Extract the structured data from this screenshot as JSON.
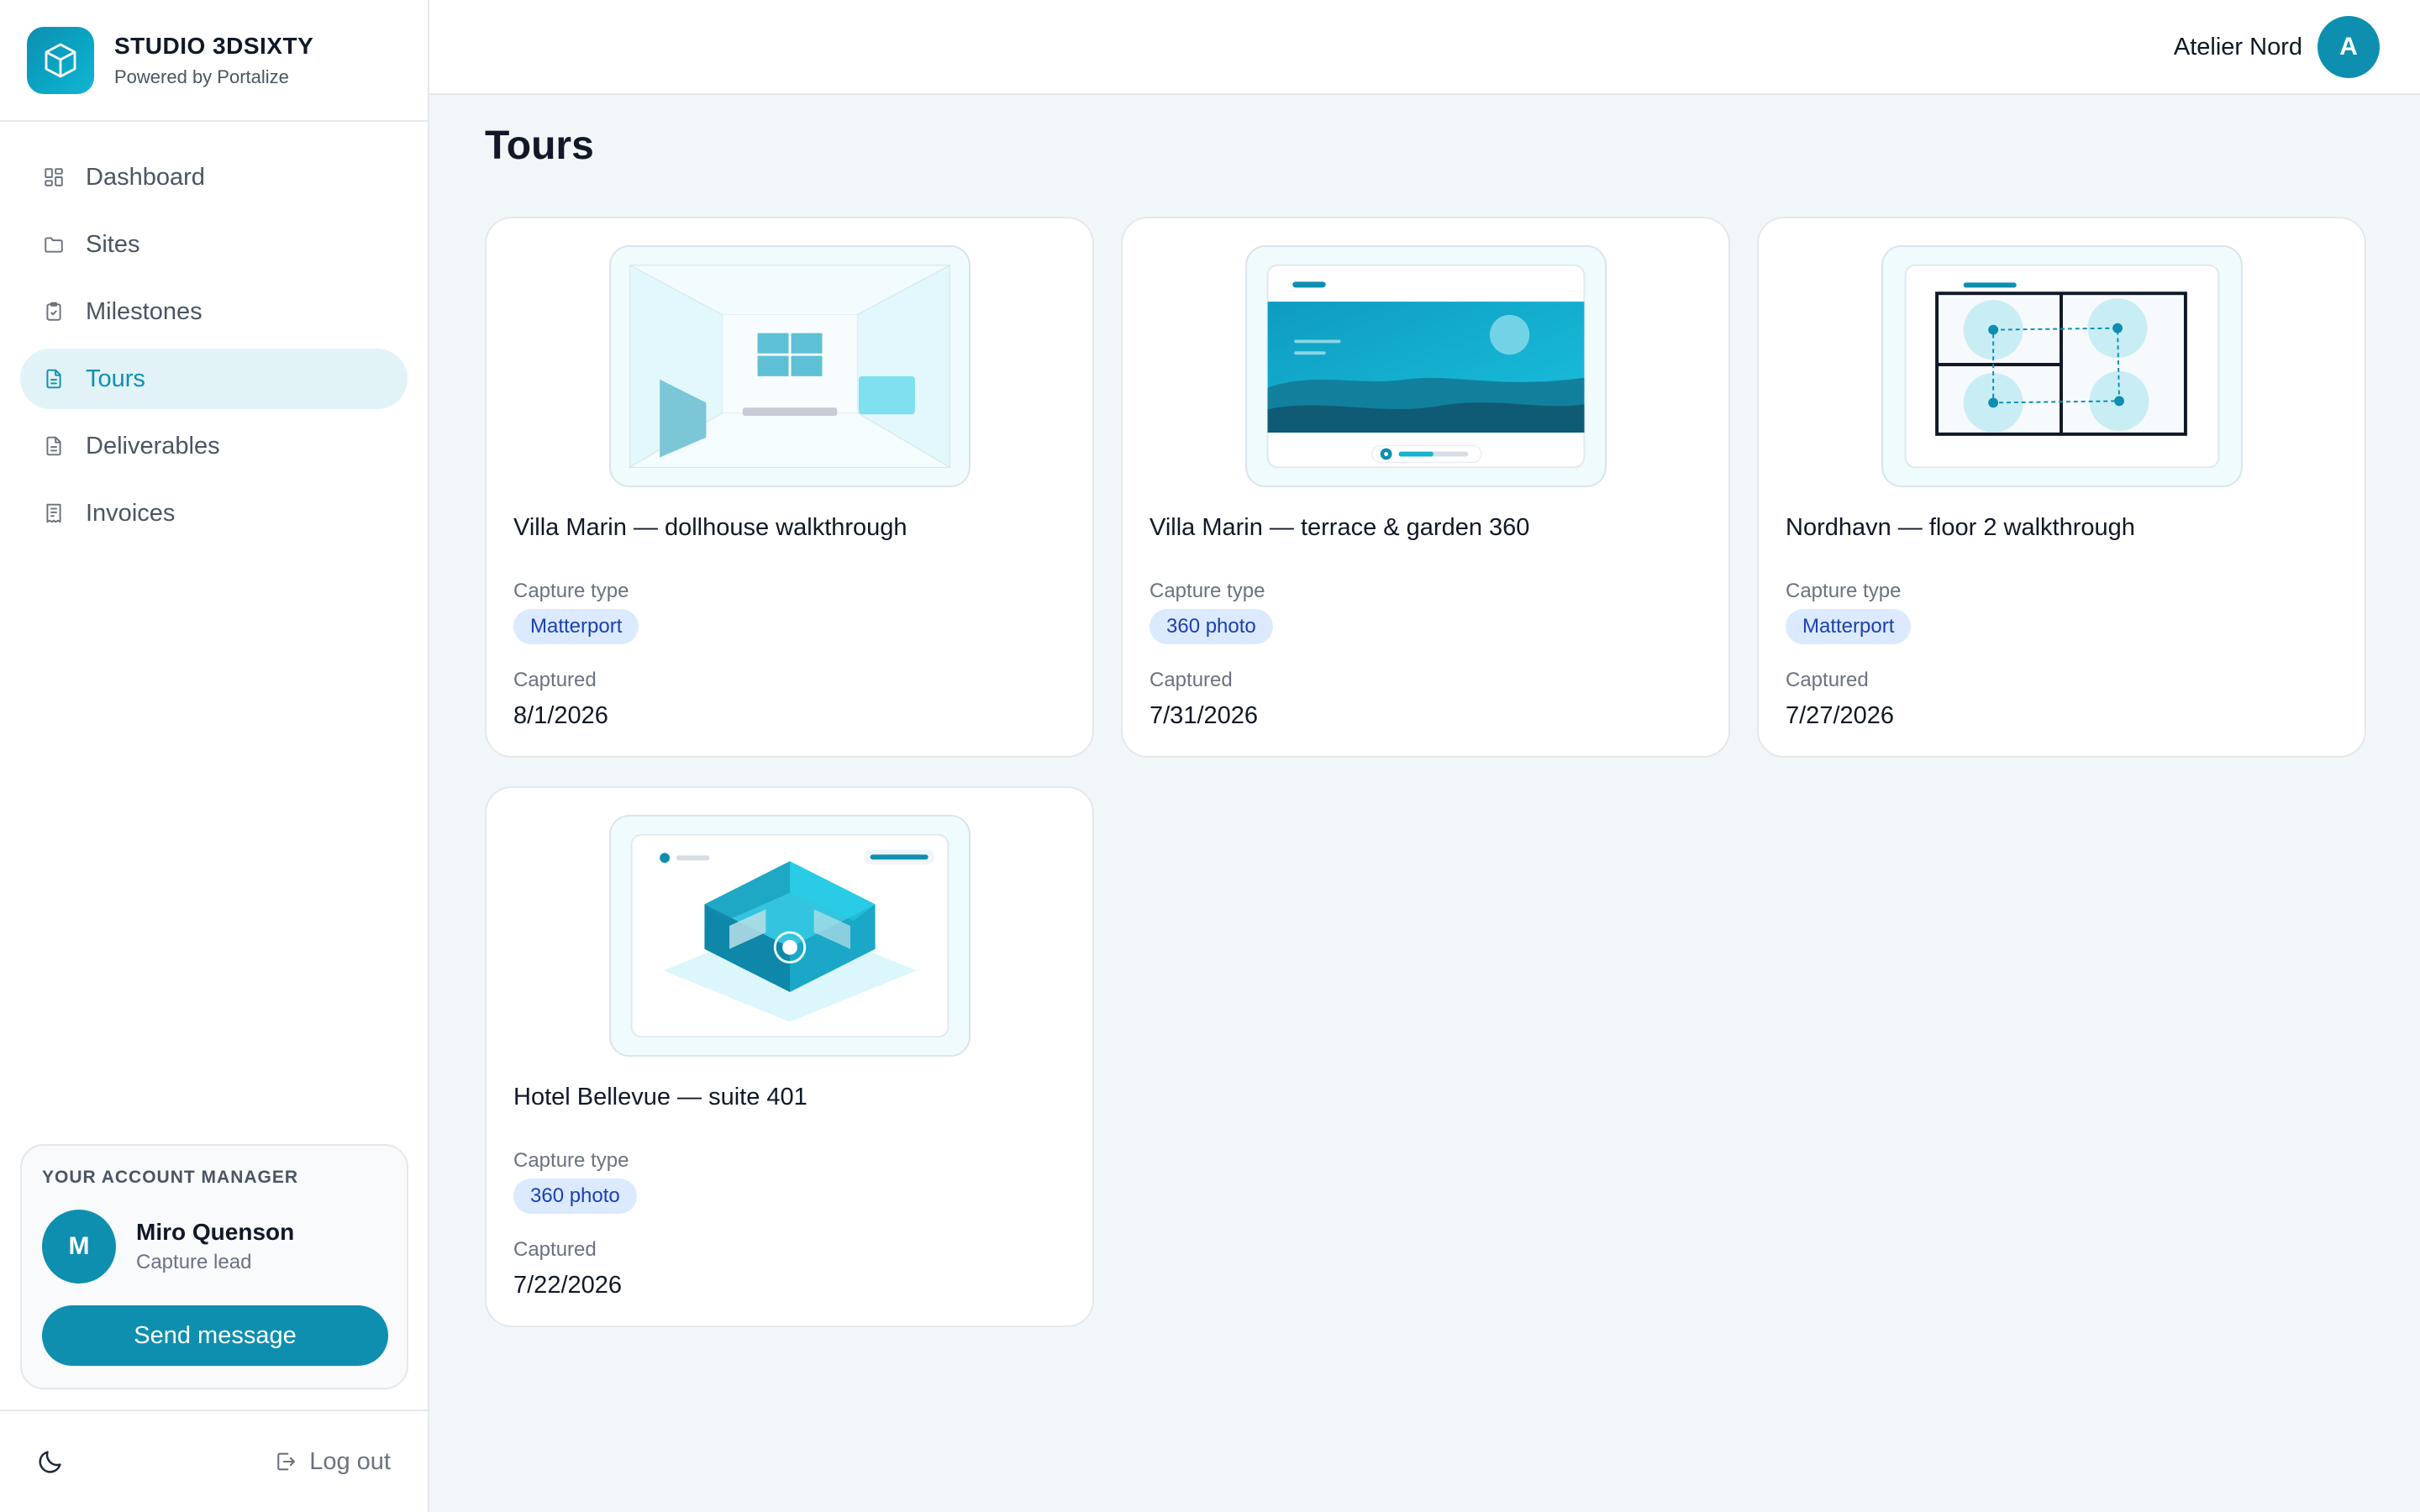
{
  "brand": {
    "title": "STUDIO 3DSIXTY",
    "subtitle": "Powered by Portalize",
    "icon": "cube-icon",
    "accent": "#0e8fb0"
  },
  "nav": {
    "items": [
      {
        "label": "Dashboard",
        "icon": "dashboard-icon",
        "active": false
      },
      {
        "label": "Sites",
        "icon": "folder-icon",
        "active": false
      },
      {
        "label": "Milestones",
        "icon": "clipboard-check-icon",
        "active": false
      },
      {
        "label": "Tours",
        "icon": "document-icon",
        "active": true
      },
      {
        "label": "Deliverables",
        "icon": "document-icon",
        "active": false
      },
      {
        "label": "Invoices",
        "icon": "receipt-icon",
        "active": false
      }
    ]
  },
  "manager": {
    "label": "YOUR ACCOUNT MANAGER",
    "initial": "M",
    "name": "Miro Quenson",
    "role": "Capture lead",
    "button": "Send message"
  },
  "footer": {
    "theme_icon": "moon-icon",
    "logout_label": "Log out",
    "logout_icon": "logout-icon"
  },
  "header": {
    "account_name": "Atelier Nord",
    "account_initial": "A"
  },
  "page": {
    "title": "Tours"
  },
  "tours": [
    {
      "title": "Villa Marin — dollhouse walkthrough",
      "capture_type_label": "Capture type",
      "capture_type": "Matterport",
      "captured_label": "Captured",
      "captured": "8/1/2026",
      "thumbnail": "room-interior"
    },
    {
      "title": "Villa Marin — terrace & garden 360",
      "capture_type_label": "Capture type",
      "capture_type": "360 photo",
      "captured_label": "Captured",
      "captured": "7/31/2026",
      "thumbnail": "landscape-panorama"
    },
    {
      "title": "Nordhavn — floor 2 walkthrough",
      "capture_type_label": "Capture type",
      "capture_type": "Matterport",
      "captured_label": "Captured",
      "captured": "7/27/2026",
      "thumbnail": "floor-plan"
    },
    {
      "title": "Hotel Bellevue — suite 401",
      "capture_type_label": "Capture type",
      "capture_type": "360 photo",
      "captured_label": "Captured",
      "captured": "7/22/2026",
      "thumbnail": "isometric-room"
    }
  ]
}
